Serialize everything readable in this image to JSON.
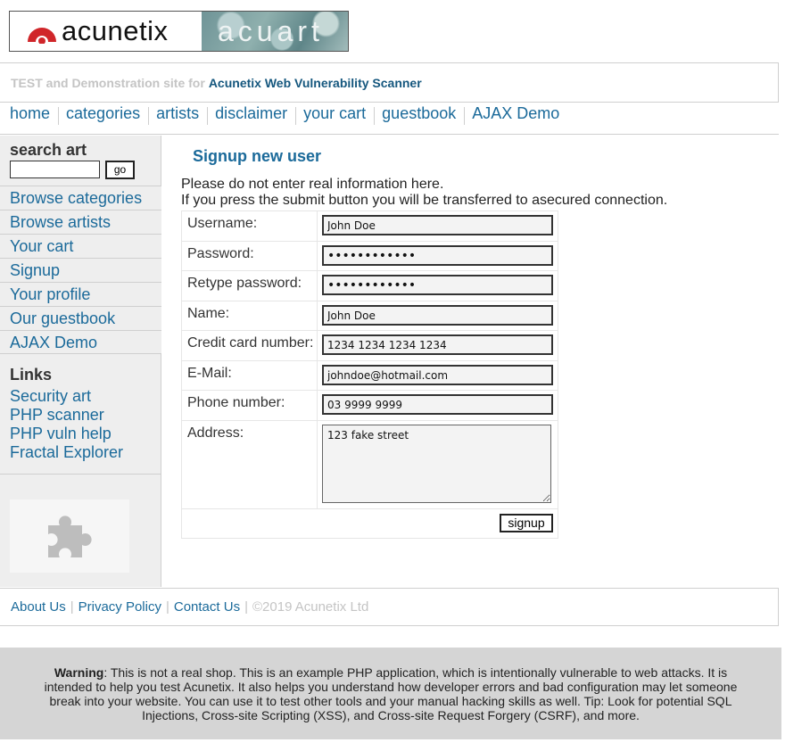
{
  "logo": {
    "brand": "acunetix",
    "sub": "acuart"
  },
  "tagline": {
    "prefix": "TEST and Demonstration site for",
    "link": "Acunetix Web Vulnerability Scanner"
  },
  "topnav": [
    "home",
    "categories",
    "artists",
    "disclaimer",
    "your cart",
    "guestbook",
    "AJAX Demo"
  ],
  "sidebar": {
    "search_heading": "search art",
    "search_value": "",
    "search_button": "go",
    "menu": [
      "Browse categories",
      "Browse artists",
      "Your cart",
      "Signup",
      "Your profile",
      "Our guestbook",
      "AJAX Demo"
    ],
    "links_heading": "Links",
    "links": [
      "Security art",
      "PHP scanner",
      "PHP vuln help",
      "Fractal Explorer"
    ],
    "image_icon": "puzzle-piece-icon"
  },
  "main": {
    "title": "Signup new user",
    "intro_line1": "Please do not enter real information here.",
    "intro_line2": "If you press the submit button you will be transferred to asecured connection.",
    "form": {
      "username_label": "Username:",
      "username_value": "John Doe",
      "password_label": "Password:",
      "password_value": "••••••••••••",
      "retype_label": "Retype password:",
      "retype_value": "••••••••••••",
      "name_label": "Name:",
      "name_value": "John Doe",
      "cc_label": "Credit card number:",
      "cc_value": "1234 1234 1234 1234",
      "email_label": "E-Mail:",
      "email_value": "johndoe@hotmail.com",
      "phone_label": "Phone number:",
      "phone_value": "03 9999 9999",
      "address_label": "Address:",
      "address_value": "123 fake street",
      "submit_label": "signup"
    }
  },
  "footer": {
    "links": [
      "About Us",
      "Privacy Policy",
      "Contact Us"
    ],
    "copyright": "©2019 Acunetix Ltd"
  },
  "warning": {
    "bold": "Warning",
    "text": ": This is not a real shop. This is an example PHP application, which is intentionally vulnerable to web attacks. It is intended to help you test Acunetix. It also helps you understand how developer errors and bad configuration may let someone break into your website. You can use it to test other tools and your manual hacking skills as well. Tip: Look for potential SQL Injections, Cross-site Scripting (XSS), and Cross-site Request Forgery (CSRF), and more."
  },
  "colors": {
    "link": "#1b6a9a",
    "brand_red": "#d0262a",
    "warning_bg": "#d5d5d5"
  }
}
